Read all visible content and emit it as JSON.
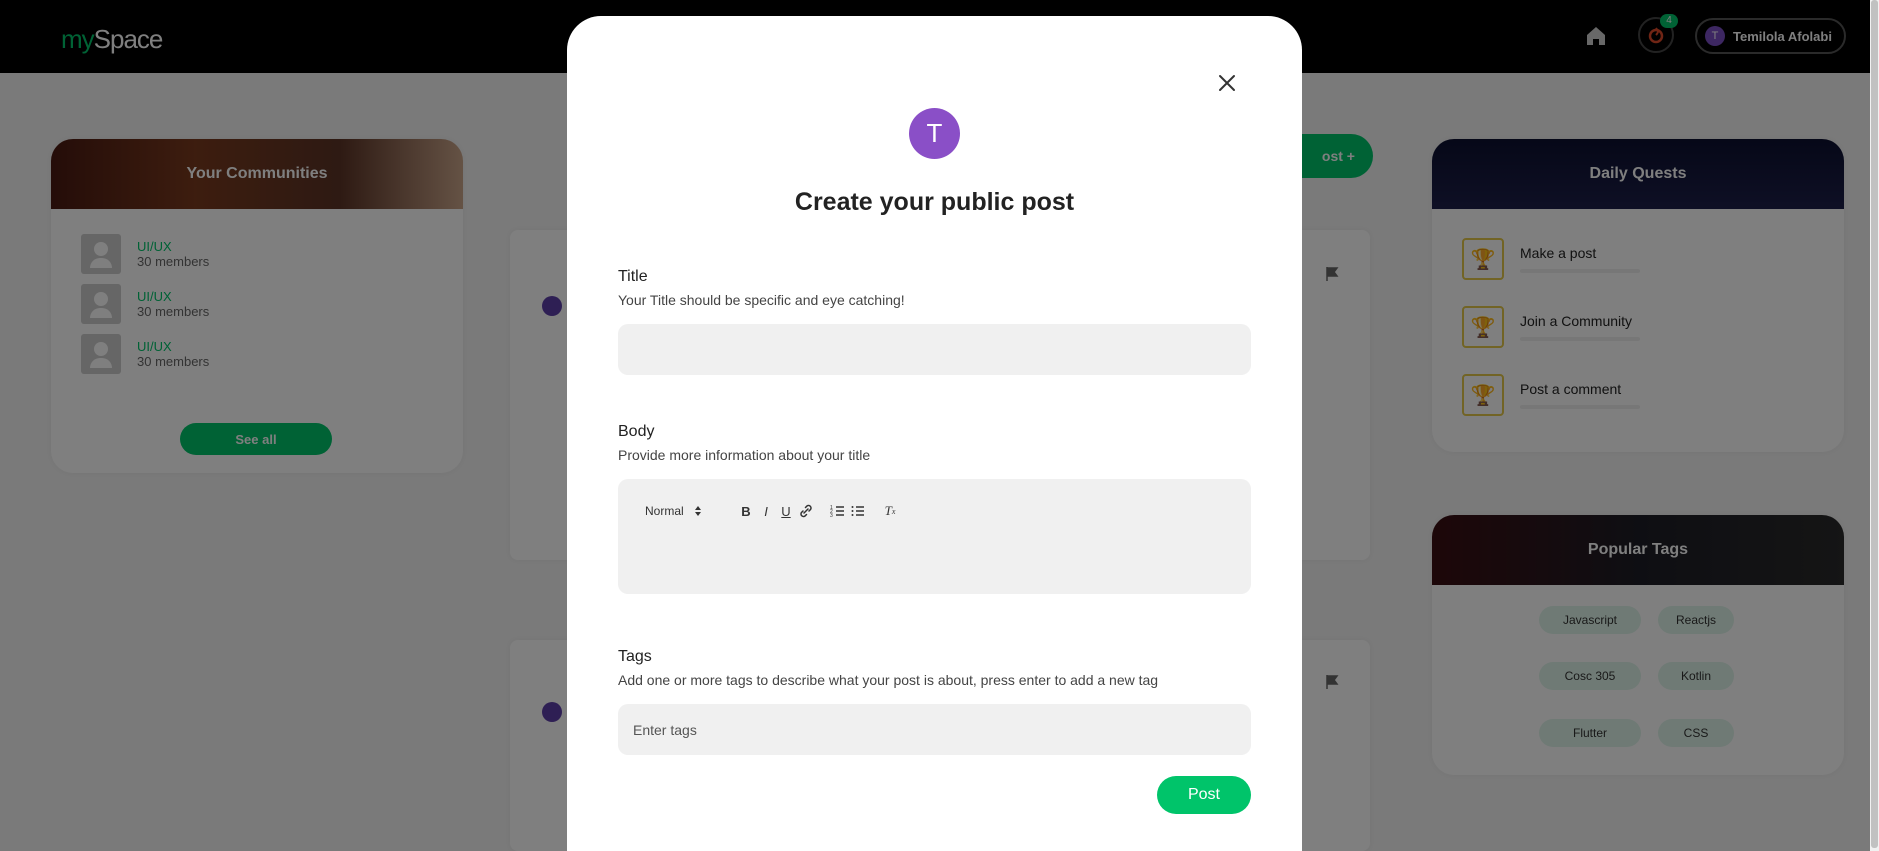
{
  "header": {
    "logo_my": "my",
    "logo_space": "Space",
    "notification_count": "4",
    "user_initial": "T",
    "user_name": "Temilola Afolabi"
  },
  "communities": {
    "title": "Your Communities",
    "items": [
      {
        "name": "UI/UX",
        "members": "30 members"
      },
      {
        "name": "UI/UX",
        "members": "30 members"
      },
      {
        "name": "UI/UX",
        "members": "30 members"
      }
    ],
    "see_all_label": "See all"
  },
  "create_post_button_label": "ost +",
  "quests": {
    "title": "Daily Quests",
    "items": [
      {
        "label": "Make a post"
      },
      {
        "label": "Join a Community"
      },
      {
        "label": "Post a comment"
      }
    ]
  },
  "popular_tags": {
    "title": "Popular Tags",
    "items": [
      "Javascript",
      "Reactjs",
      "Cosc 305",
      "Kotlin",
      "Flutter",
      "CSS"
    ]
  },
  "modal": {
    "avatar_initial": "T",
    "title": "Create your public post",
    "title_field": {
      "label": "Title",
      "hint": "Your Title should be specific and eye catching!",
      "value": ""
    },
    "body_field": {
      "label": "Body",
      "hint": "Provide more information about your title",
      "format_select": "Normal"
    },
    "tags_field": {
      "label": "Tags",
      "hint": "Add one or more tags to describe what your post is about, press enter to add a new tag",
      "placeholder": "Enter tags"
    },
    "post_button_label": "Post"
  },
  "colors": {
    "accent": "#00c46a",
    "avatar": "#8a4fc7"
  }
}
